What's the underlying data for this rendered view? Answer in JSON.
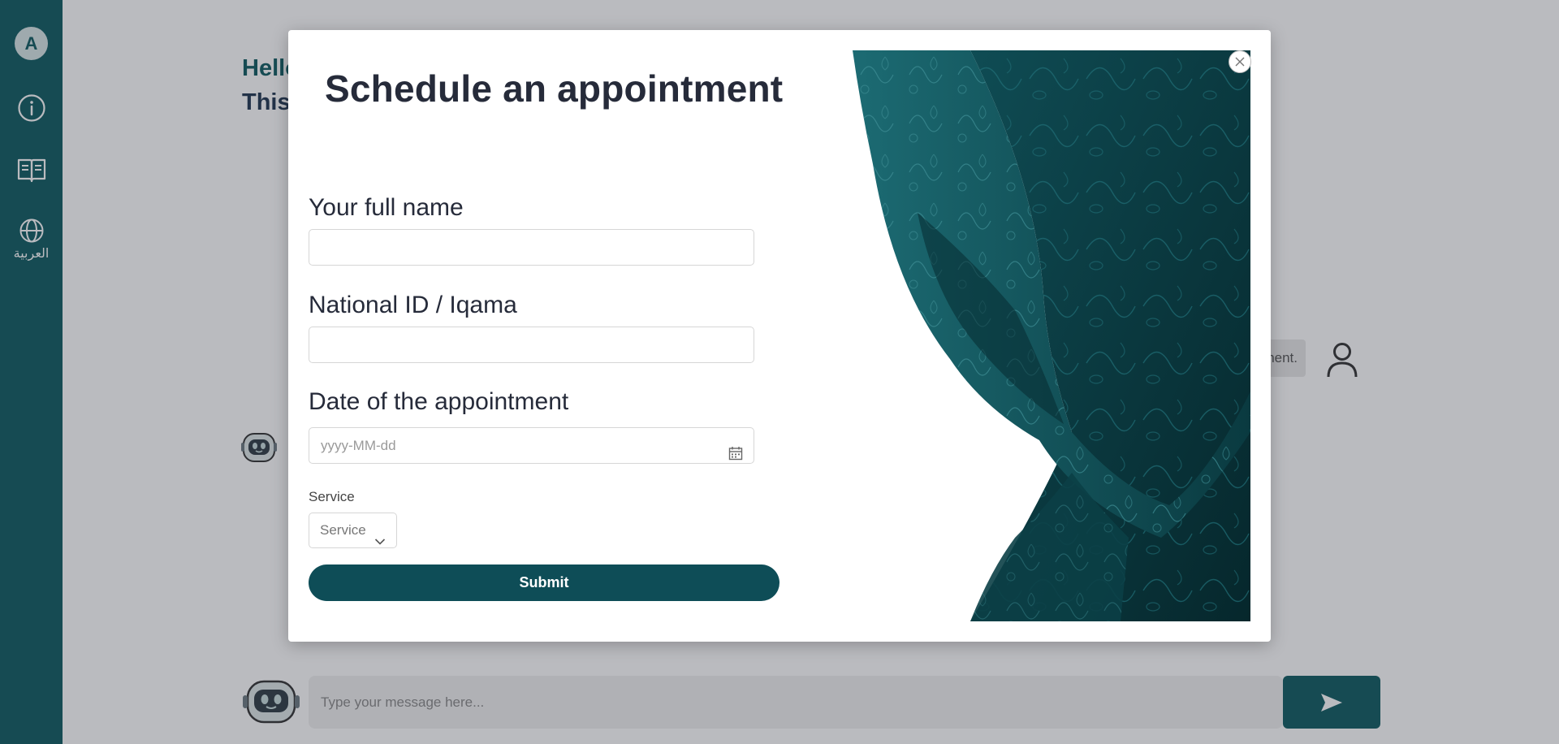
{
  "sidebar": {
    "avatar_letter": "A",
    "items": [
      {
        "icon": "info-icon"
      },
      {
        "icon": "book-icon"
      },
      {
        "icon": "globe-icon",
        "label": "العربية"
      }
    ]
  },
  "page": {
    "greeting": "Hello",
    "subtitle": "This",
    "user_message_fragment": "nent.",
    "chat_placeholder": "Type your message here..."
  },
  "modal": {
    "title": "Schedule an appointment",
    "fields": {
      "full_name_label": "Your full name",
      "national_id_label": "National ID / Iqama",
      "date_label": "Date of the appointment",
      "date_placeholder": "yyyy-MM-dd",
      "service_label": "Service",
      "service_selected": "Service"
    },
    "submit_label": "Submit"
  },
  "colors": {
    "brand": "#0e5a60",
    "button": "#0e4d57",
    "title": "#262b3a"
  }
}
